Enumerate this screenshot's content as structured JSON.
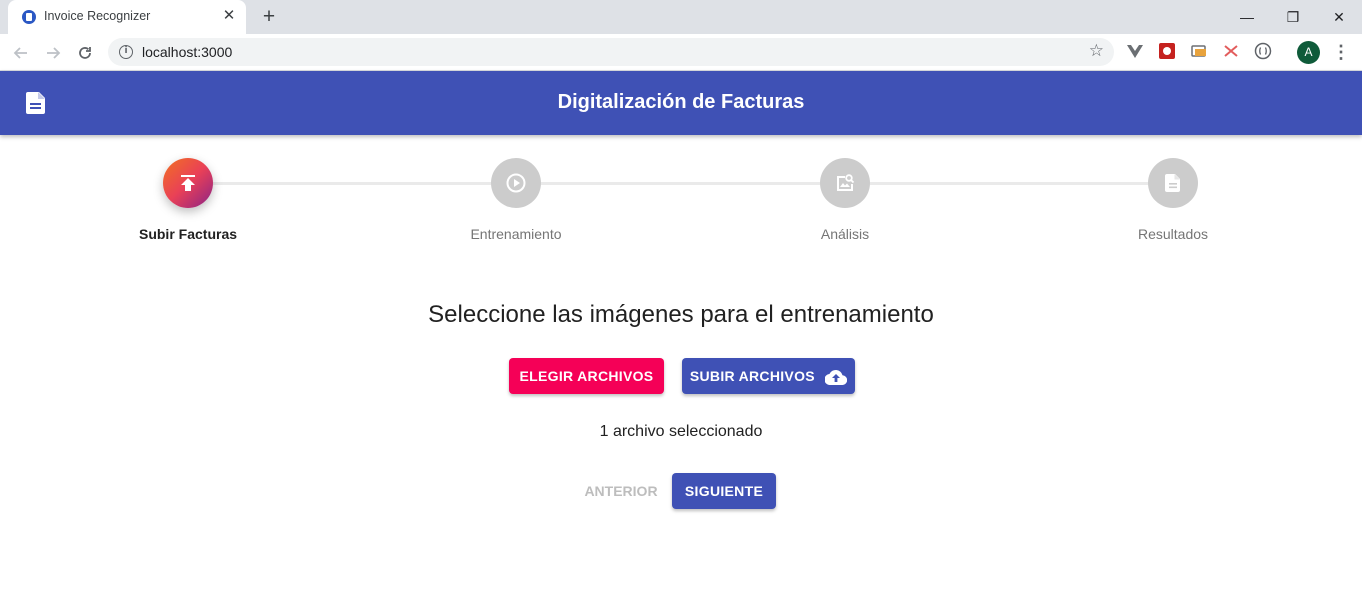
{
  "browser": {
    "tab_title": "Invoice Recognizer",
    "tab_close": "✕",
    "new_tab": "+",
    "url": "localhost:3000",
    "avatar_letter": "A",
    "window_controls": {
      "minimize": "—",
      "restore": "❐",
      "close": "✕"
    }
  },
  "appbar": {
    "title": "Digitalización de Facturas",
    "icon": "document-icon"
  },
  "stepper": {
    "active_index": 0,
    "steps": [
      {
        "label": "Subir Facturas",
        "icon": "upload-icon"
      },
      {
        "label": "Entrenamiento",
        "icon": "play-circle-icon"
      },
      {
        "label": "Análisis",
        "icon": "image-search-icon"
      },
      {
        "label": "Resultados",
        "icon": "description-icon"
      }
    ]
  },
  "main": {
    "title": "Seleccione las imágenes para el entrenamiento",
    "choose_button": "ELEGIR ARCHIVOS",
    "upload_button": "SUBIR ARCHIVOS",
    "file_status": "1 archivo seleccionado",
    "prev_button": "ANTERIOR",
    "next_button": "SIGUIENTE"
  },
  "colors": {
    "primary": "#3f51b5",
    "secondary": "#f50057",
    "step_inactive": "#cccccc"
  }
}
